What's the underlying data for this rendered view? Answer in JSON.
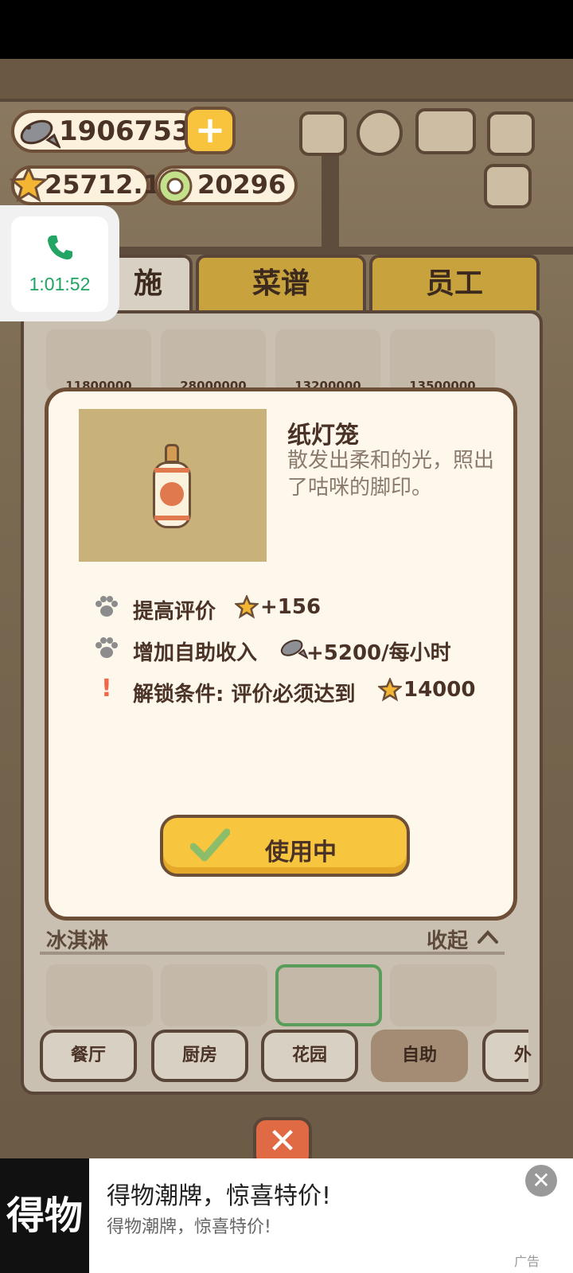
{
  "hud": {
    "fish_count": "1906753",
    "star_rating": "25712.1",
    "coin_count": "20296"
  },
  "call": {
    "timer": "1:01:52"
  },
  "tabs": [
    {
      "label": "施"
    },
    {
      "label": "菜谱"
    },
    {
      "label": "员工"
    }
  ],
  "grid_prices": [
    "11800000",
    "28000000",
    "13200000",
    "13500000"
  ],
  "item": {
    "name": "纸灯笼",
    "description": "散发出柔和的光，照出了咕咪的脚印。",
    "stats": [
      {
        "label": "提高评价",
        "value": "+156"
      },
      {
        "label": "增加自助收入",
        "value": "+5200/每小时"
      },
      {
        "label": "解锁条件: 评价必须达到",
        "value": "14000"
      }
    ],
    "action_label": "使用中"
  },
  "section": {
    "title": "冰淇淋",
    "collapse_label": "收起"
  },
  "categories": [
    {
      "label": "餐厅"
    },
    {
      "label": "厨房"
    },
    {
      "label": "花园"
    },
    {
      "label": "自助"
    },
    {
      "label": "外"
    }
  ],
  "ad": {
    "logo_text": "得物",
    "title": "得物潮牌，惊喜特价!",
    "subtitle": "得物潮牌，惊喜特价!",
    "tag": "广告"
  },
  "colors": {
    "accent_yellow": "#f8c43d",
    "panel_border": "#6d4e36",
    "call_green": "#22a463",
    "warning_red": "#f2654a"
  }
}
